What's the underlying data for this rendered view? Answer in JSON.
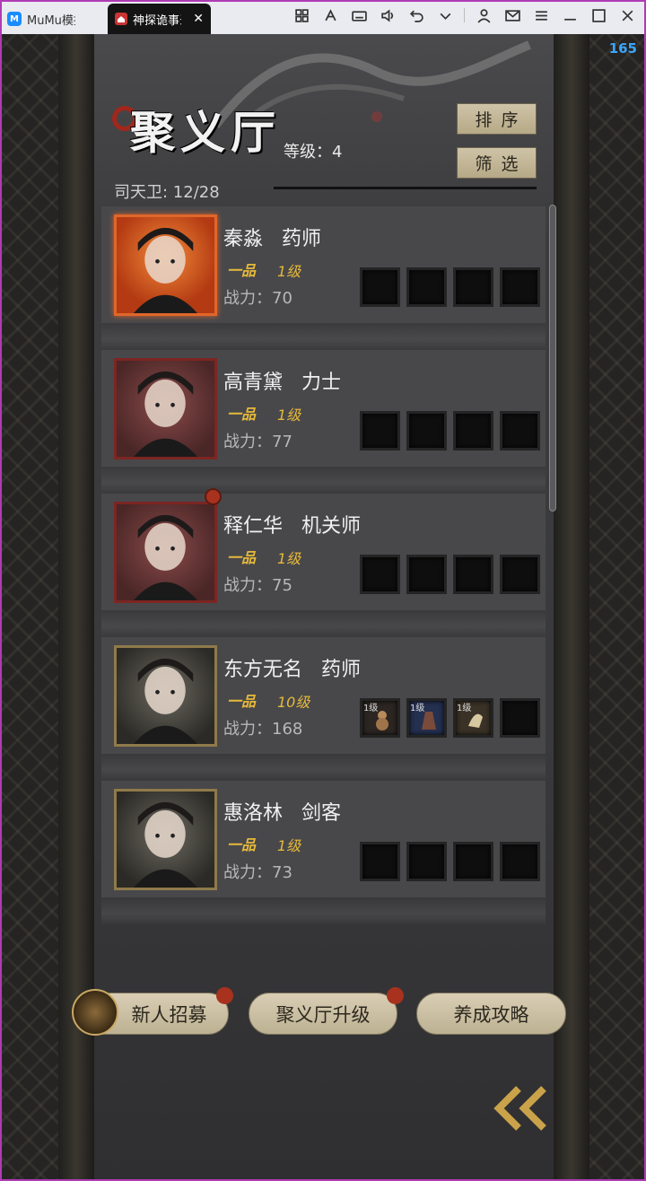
{
  "window": {
    "tabs": [
      {
        "label": "MuMu模拟器"
      },
      {
        "label": "神探诡事录"
      }
    ],
    "fps": "165",
    "toolbar_icons": [
      "multi-window-icon",
      "keymap-icon",
      "keyboard-icon",
      "volume-icon",
      "undo-icon",
      "dropdown-icon",
      "account-icon",
      "mail-icon",
      "menu-icon",
      "minimize-icon",
      "maximize-icon",
      "close-icon"
    ]
  },
  "header": {
    "title": "聚义厅",
    "level": "等级：4",
    "sort_label": "排序",
    "filter_label": "筛选",
    "guards": "司天卫: 12/28"
  },
  "members": [
    {
      "name": "秦淼   药师",
      "rank": "一品",
      "level": "1级",
      "power": "战力：70",
      "frame": "orange",
      "dot": false,
      "slots": [
        "",
        "",
        "",
        ""
      ]
    },
    {
      "name": "高青黛   力士",
      "rank": "一品",
      "level": "1级",
      "power": "战力：77",
      "frame": "red",
      "dot": false,
      "slots": [
        "",
        "",
        "",
        ""
      ]
    },
    {
      "name": "释仁华   机关师",
      "rank": "一品",
      "level": "1级",
      "power": "战力：75",
      "frame": "red",
      "dot": true,
      "slots": [
        "",
        "",
        "",
        ""
      ]
    },
    {
      "name": "东方无名   药师",
      "rank": "一品",
      "level": "10级",
      "power": "战力：168",
      "frame": "gold",
      "dot": false,
      "slots": [
        "1级",
        "1级",
        "1级",
        ""
      ]
    },
    {
      "name": "惠洛林   剑客",
      "rank": "一品",
      "level": "1级",
      "power": "战力：73",
      "frame": "gold",
      "dot": false,
      "slots": [
        "",
        "",
        "",
        ""
      ]
    }
  ],
  "footer": {
    "recruit_label": "新人招募",
    "upgrade_label": "聚义厅升级",
    "guide_label": "养成攻略"
  },
  "colors": {
    "accent_gold": "#e6b93a",
    "notify_red": "#a8321e",
    "button_beige": "#cfc3a8"
  }
}
